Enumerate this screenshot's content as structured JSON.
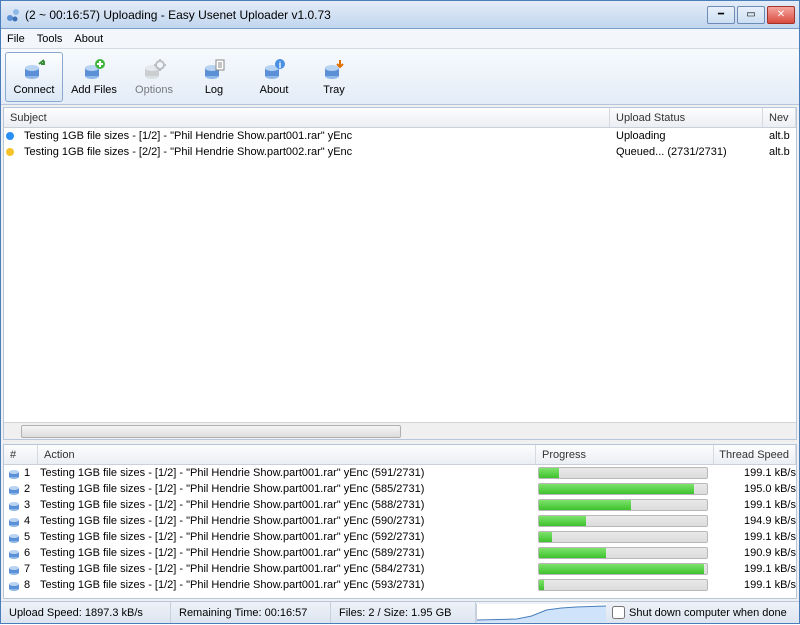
{
  "window": {
    "title": "(2 ~ 00:16:57) Uploading - Easy Usenet Uploader v1.0.73"
  },
  "menu": {
    "file": "File",
    "tools": "Tools",
    "about": "About"
  },
  "toolbar": {
    "connect": "Connect",
    "addfiles": "Add Files",
    "options": "Options",
    "log": "Log",
    "about": "About",
    "tray": "Tray"
  },
  "toppane": {
    "headers": {
      "subject": "Subject",
      "status": "Upload Status",
      "news": "Nev"
    },
    "rows": [
      {
        "dot": "#2a8ff4",
        "subject": "Testing 1GB file sizes - [1/2] - \"Phil Hendrie Show.part001.rar\" yEnc",
        "status": "Uploading",
        "news": "alt.b"
      },
      {
        "dot": "#f4c22a",
        "subject": "Testing 1GB file sizes - [2/2] - \"Phil Hendrie Show.part002.rar\" yEnc",
        "status": "Queued... (2731/2731)",
        "news": "alt.b"
      }
    ]
  },
  "bottompane": {
    "headers": {
      "num": "#",
      "action": "Action",
      "progress": "Progress",
      "speed": "Thread Speed"
    },
    "rows": [
      {
        "n": "1",
        "action": "Testing 1GB file sizes - [1/2] - \"Phil Hendrie Show.part001.rar\" yEnc (591/2731)",
        "pct": 12,
        "speed": "199.1 kB/s"
      },
      {
        "n": "2",
        "action": "Testing 1GB file sizes - [1/2] - \"Phil Hendrie Show.part001.rar\" yEnc (585/2731)",
        "pct": 92,
        "speed": "195.0 kB/s"
      },
      {
        "n": "3",
        "action": "Testing 1GB file sizes - [1/2] - \"Phil Hendrie Show.part001.rar\" yEnc (588/2731)",
        "pct": 55,
        "speed": "199.1 kB/s"
      },
      {
        "n": "4",
        "action": "Testing 1GB file sizes - [1/2] - \"Phil Hendrie Show.part001.rar\" yEnc (590/2731)",
        "pct": 28,
        "speed": "194.9 kB/s"
      },
      {
        "n": "5",
        "action": "Testing 1GB file sizes - [1/2] - \"Phil Hendrie Show.part001.rar\" yEnc (592/2731)",
        "pct": 8,
        "speed": "199.1 kB/s"
      },
      {
        "n": "6",
        "action": "Testing 1GB file sizes - [1/2] - \"Phil Hendrie Show.part001.rar\" yEnc (589/2731)",
        "pct": 40,
        "speed": "190.9 kB/s"
      },
      {
        "n": "7",
        "action": "Testing 1GB file sizes - [1/2] - \"Phil Hendrie Show.part001.rar\" yEnc (584/2731)",
        "pct": 98,
        "speed": "199.1 kB/s"
      },
      {
        "n": "8",
        "action": "Testing 1GB file sizes - [1/2] - \"Phil Hendrie Show.part001.rar\" yEnc (593/2731)",
        "pct": 3,
        "speed": "199.1 kB/s"
      }
    ]
  },
  "status": {
    "speed": "Upload Speed: 1897.3 kB/s",
    "remaining": "Remaining Time: 00:16:57",
    "files": "Files: 2 / Size: 1.95 GB",
    "shutdown": "Shut down computer when done"
  },
  "colors": {
    "accent": "#4a7ebb"
  }
}
